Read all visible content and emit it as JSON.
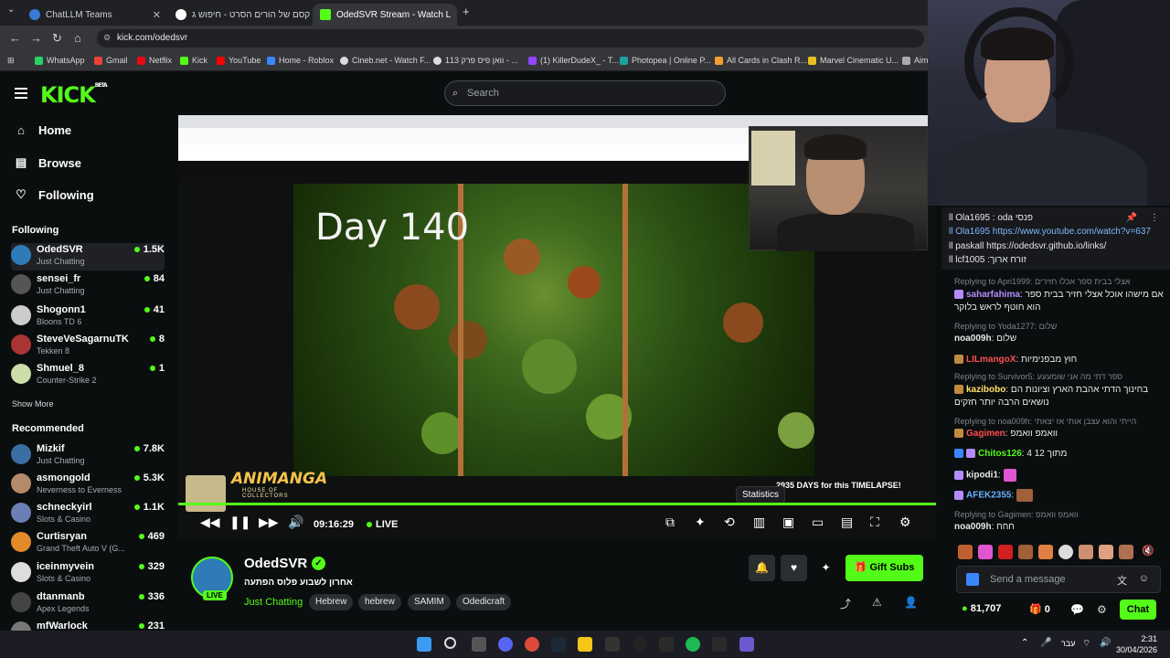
{
  "browser": {
    "tabs": [
      {
        "title": "ChatLLM Teams",
        "active": false,
        "color": "#3a7bd5"
      },
      {
        "title": "קסם של הורים הסרט - חיפוש ג",
        "active": false,
        "color": "#ffffff"
      },
      {
        "title": "OdedSVR Stream - Watch L",
        "active": true,
        "color": "#53fc18"
      }
    ],
    "url": "kick.com/odedsvr",
    "bookmarks": [
      "WhatsApp",
      "Gmail",
      "Netflix",
      "Kick",
      "YouTube",
      "Home - Roblox",
      "Cineb.net - Watch F...",
      "וואן פיס פרק 113 - ...",
      "(1) KillerDudeX_ - T...",
      "Photopea | Online P...",
      "All Cards in Clash R...",
      "Marvel Cinematic U...",
      "Aim"
    ]
  },
  "kick": {
    "logo": "KICK",
    "logo_sup": "BETA",
    "search_placeholder": "Search",
    "accent": "#53fc18"
  },
  "sidebar": {
    "nav": [
      {
        "label": "Home",
        "icon": "home-icon"
      },
      {
        "label": "Browse",
        "icon": "browse-icon"
      },
      {
        "label": "Following",
        "icon": "heart-icon"
      }
    ],
    "following_title": "Following",
    "following": [
      {
        "name": "OdedSVR",
        "category": "Just Chatting",
        "viewers": "1.5K",
        "color": "#2e7bb8"
      },
      {
        "name": "sensei_fr",
        "category": "Just Chatting",
        "viewers": "84",
        "color": "#555"
      },
      {
        "name": "Shogonn1",
        "category": "Bloons TD 6",
        "viewers": "41",
        "color": "#ccc"
      },
      {
        "name": "SteveVeSagarnuTK",
        "category": "Tekken 8",
        "viewers": "8",
        "color": "#a33"
      },
      {
        "name": "Shmuel_8",
        "category": "Counter-Strike 2",
        "viewers": "1",
        "color": "#cda"
      }
    ],
    "show_more": "Show More",
    "recommended_title": "Recommended",
    "recommended": [
      {
        "name": "Mizkif",
        "category": "Just Chatting",
        "viewers": "7.8K",
        "color": "#3a6ea5"
      },
      {
        "name": "asmongold",
        "category": "Neverness to Everness",
        "viewers": "5.3K",
        "color": "#b48a6a"
      },
      {
        "name": "schneckyirl",
        "category": "Slots & Casino",
        "viewers": "1.1K",
        "color": "#6a7fb4"
      },
      {
        "name": "Curtisryan",
        "category": "Grand Theft Auto V (G...",
        "viewers": "469",
        "color": "#e08a2a"
      },
      {
        "name": "iceinmyvein",
        "category": "Slots & Casino",
        "viewers": "329",
        "color": "#ddd"
      },
      {
        "name": "dtanmanb",
        "category": "Apex Legends",
        "viewers": "336",
        "color": "#444"
      },
      {
        "name": "mfWarlock",
        "category": "",
        "viewers": "231",
        "color": "#777"
      }
    ]
  },
  "video": {
    "day_text": "Day 140",
    "banner": "2935 DAYS for this TIMELAPSE!",
    "animanga_title": "ANIMANGA",
    "animanga_sub": "HOUSE OF COLLECTORS",
    "timecode": "09:16:29",
    "live_label": "LIVE",
    "tooltip": "Statistics"
  },
  "channel": {
    "name": "OdedSVR",
    "title": "אחרון לשבוע פלוס הפתעה",
    "category": "Just Chatting",
    "tags": [
      "Hebrew",
      "hebrew",
      "SAMIM",
      "Odedicraft"
    ],
    "live_badge": "LIVE",
    "gift_subs": "Gift Subs"
  },
  "chat": {
    "pinned": [
      "ll Ola1695 : oda פנסי ",
      "ll Ola1695 https://www.youtube.com/watch?v=637",
      "ll paskall https://odedsvr.github.io/links/",
      "ll lcf1005 :זורח ארוך"
    ],
    "messages": [
      {
        "reply": "Replying to Apri1999: אצלי בבית ספר אכלו חזירים",
        "user": "saharfahima",
        "color": "#b48cff",
        "text": "אם מישהו אוכל אצלי חזיר בבית ספר הוא חוטף לראש בלוקר"
      },
      {
        "reply": "Replying to Yoda1277: שלום",
        "user": "noa009h",
        "color": "#ffffff",
        "text": "שלום"
      },
      {
        "reply": "",
        "user": "LILmangoX",
        "color": "#ff4d4d",
        "text": "חוץ מבפנימיות"
      },
      {
        "reply": "Replying to Survivor5: ספר דתי מה אני שומעעע",
        "user": "kazibobo",
        "color": "#ffe066",
        "text": "בחינוך הדתי אהבת הארץ וציונות הם נושאים הרבה יותר חזקים"
      },
      {
        "reply": "Replying to noa009h: הייתי והוא עצבן אותי אז יצאתי",
        "user": "Gagimen",
        "color": "#ff4d4d",
        "text": "וואמפ וואמפ"
      },
      {
        "reply": "",
        "user": "Chitos126",
        "color": "#53fc18",
        "text": "מתוך 12 4"
      },
      {
        "reply": "",
        "user": "kipodi1",
        "color": "#ffffff",
        "text": ""
      },
      {
        "reply": "",
        "user": "AFEK2355",
        "color": "#66b3ff",
        "text": ""
      },
      {
        "reply": "Replying to Gagimen: וואמפ וואמפ",
        "user": "noa009h",
        "color": "#ffffff",
        "text": "חחח"
      }
    ],
    "input_placeholder": "Send a message",
    "points": "81,707",
    "zero": "0",
    "chat_button": "Chat"
  },
  "taskbar": {
    "lang": "עבר",
    "time": "2:31",
    "date": "30/04/2026"
  }
}
